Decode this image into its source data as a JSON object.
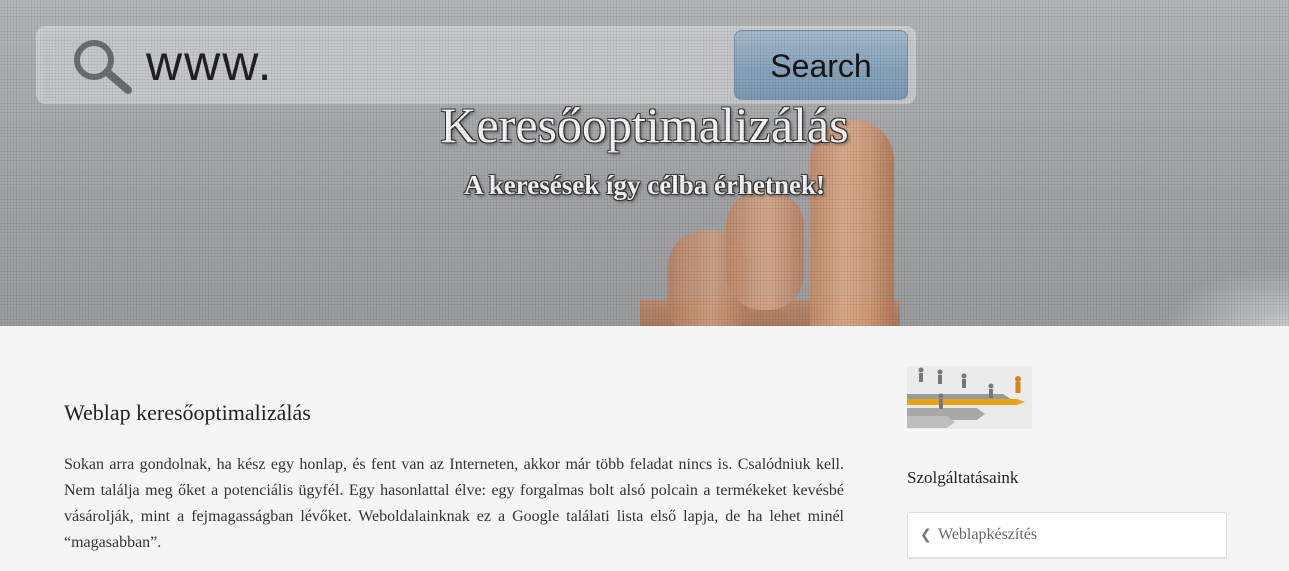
{
  "hero": {
    "url_text": "www.",
    "search_label": "Search",
    "title": "Keresőoptimalizálás",
    "subtitle": "A keresések így célba érhetnek!"
  },
  "article": {
    "title": "Weblap keresőoptimalizálás",
    "paragraph": "Sokan arra gondolnak,  ha kész egy honlap, és fent van az Interneten, akkor már több feladat nincs is. Csalódniuk kell. Nem találja meg őket a potenciális ügyfél. Egy hasonlattal élve: egy forgalmas bolt alsó polcain a termékeket kevésbé vásárolják, mint a fejmagasságban lévőket. Weboldalainknak ez a Google találati lista első lapja, de ha lehet minél “magasabban”."
  },
  "sidebar": {
    "image_icon": "running-figures-arrows-image",
    "heading": "Szolgáltatásaink",
    "items": [
      {
        "label": "Weblapkészítés",
        "icon": "chevron-left-icon"
      }
    ]
  },
  "colors": {
    "page_background": "#f5f5f5",
    "search_button": "#8ba9c2",
    "arrow_highlight": "#e8a317"
  }
}
